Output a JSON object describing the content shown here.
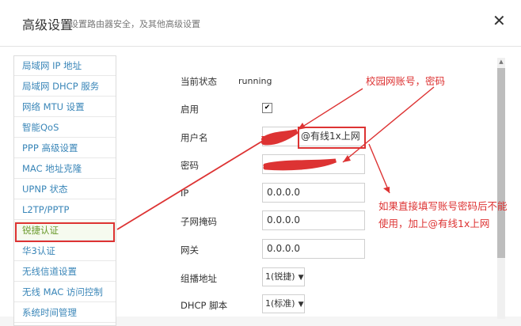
{
  "dialog": {
    "title": "高级设置",
    "subtitle": "设置路由器安全，及其他高级设置",
    "close_glyph": "✕"
  },
  "sidebar": {
    "items": [
      {
        "label": "局域网 IP 地址"
      },
      {
        "label": "局域网 DHCP 服务"
      },
      {
        "label": "网络 MTU 设置"
      },
      {
        "label": "智能QoS"
      },
      {
        "label": "PPP 高级设置"
      },
      {
        "label": "MAC 地址克隆"
      },
      {
        "label": "UPNP 状态"
      },
      {
        "label": "L2TP/PPTP"
      },
      {
        "label": "锐捷认证",
        "active": true
      },
      {
        "label": "华3认证"
      },
      {
        "label": "无线信道设置"
      },
      {
        "label": "无线 MAC 访问控制"
      },
      {
        "label": "系统时间管理"
      }
    ]
  },
  "form": {
    "status_label": "当前状态",
    "status_value": "running",
    "enable_label": "启用",
    "enable_checked_glyph": "✔",
    "username_label": "用户名",
    "username_value": "@有线1x上网",
    "password_label": "密码",
    "ip_label": "IP",
    "ip_value": "0.0.0.0",
    "mask_label": "子网掩码",
    "mask_value": "0.0.0.0",
    "gateway_label": "网关",
    "gateway_value": "0.0.0.0",
    "multicast_label": "组播地址",
    "multicast_value": "1(锐捷)",
    "dhcp_label": "DHCP 脚本",
    "dhcp_value": "1(标准)"
  },
  "annotations": {
    "top_note": "校园网账号，密码",
    "side_note_line1": "如果直接填写账号密码后不能",
    "side_note_line2": "使用，加上@有线1x上网"
  },
  "colors": {
    "accent_link": "#3a86b8",
    "active_item": "#6a9a2c",
    "annotation_red": "#d33"
  },
  "icons": {
    "close": "close-icon",
    "checkbox": "checkmark-icon",
    "dropdown": "chevron-down-icon"
  }
}
